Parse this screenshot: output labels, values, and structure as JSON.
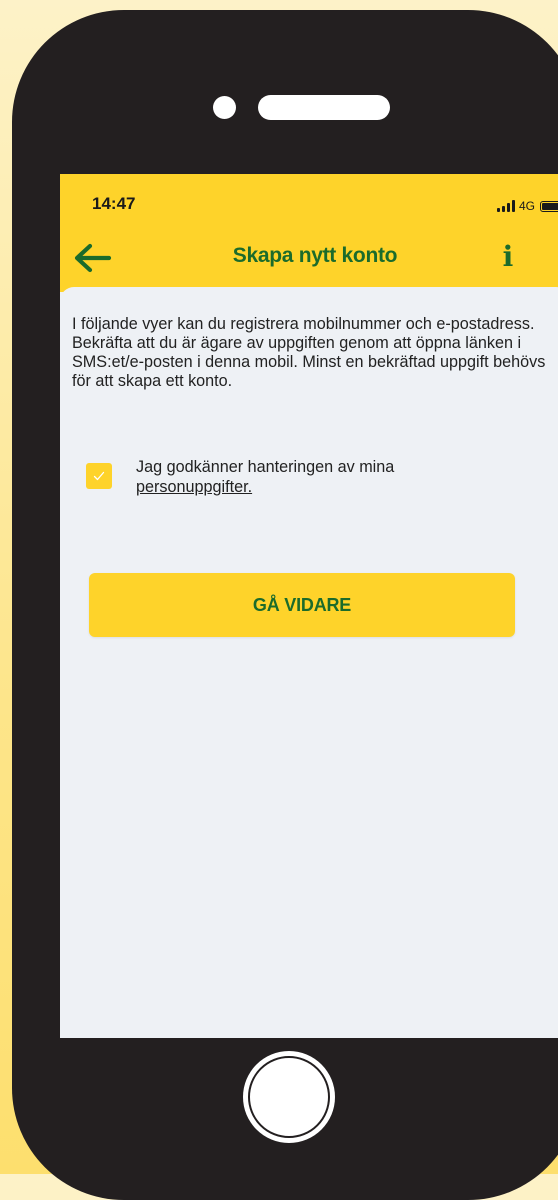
{
  "status_bar": {
    "time": "14:47",
    "network": "4G"
  },
  "header": {
    "title": "Skapa nytt konto",
    "back_icon": "arrow-left-icon",
    "info_icon": "info-icon",
    "info_label": "i"
  },
  "main": {
    "intro_text": "I följande vyer kan du registrera mobilnummer och e-postadress. Bekräfta att du är ägare av uppgiften genom att öppna länken i SMS:et/e-posten i denna mobil. Minst en bekräftad uppgift behövs för att skapa ett konto.",
    "consent": {
      "checked": true,
      "text": "Jag godkänner hanteringen av mina",
      "link_text": "personuppgifter."
    },
    "continue_label": "GÅ VIDARE"
  },
  "colors": {
    "accent_yellow": "#fed32a",
    "brand_green": "#1b6b2b",
    "screen_background": "#eef1f5",
    "phone_body": "#231f20"
  }
}
